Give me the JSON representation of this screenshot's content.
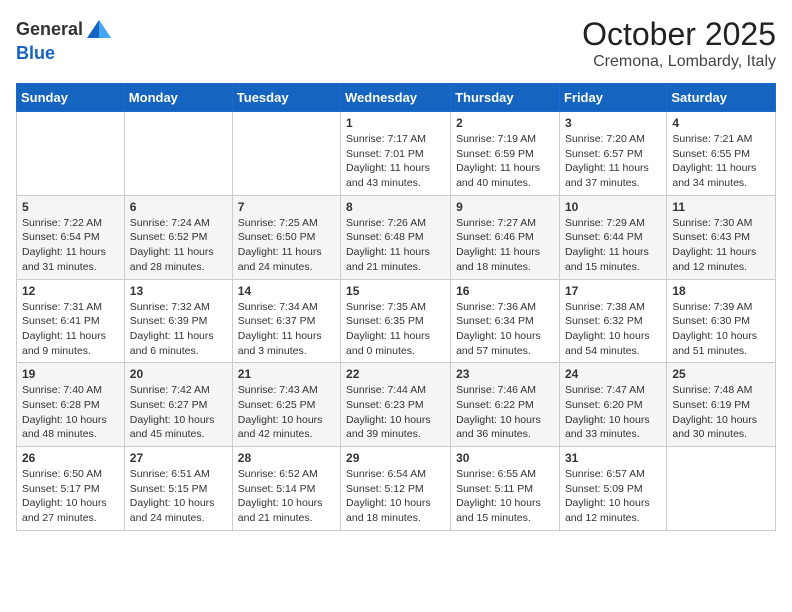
{
  "header": {
    "logo_general": "General",
    "logo_blue": "Blue",
    "month_title": "October 2025",
    "location": "Cremona, Lombardy, Italy"
  },
  "weekdays": [
    "Sunday",
    "Monday",
    "Tuesday",
    "Wednesday",
    "Thursday",
    "Friday",
    "Saturday"
  ],
  "weeks": [
    [
      {
        "day": "",
        "info": ""
      },
      {
        "day": "",
        "info": ""
      },
      {
        "day": "",
        "info": ""
      },
      {
        "day": "1",
        "info": "Sunrise: 7:17 AM\nSunset: 7:01 PM\nDaylight: 11 hours and 43 minutes."
      },
      {
        "day": "2",
        "info": "Sunrise: 7:19 AM\nSunset: 6:59 PM\nDaylight: 11 hours and 40 minutes."
      },
      {
        "day": "3",
        "info": "Sunrise: 7:20 AM\nSunset: 6:57 PM\nDaylight: 11 hours and 37 minutes."
      },
      {
        "day": "4",
        "info": "Sunrise: 7:21 AM\nSunset: 6:55 PM\nDaylight: 11 hours and 34 minutes."
      }
    ],
    [
      {
        "day": "5",
        "info": "Sunrise: 7:22 AM\nSunset: 6:54 PM\nDaylight: 11 hours and 31 minutes."
      },
      {
        "day": "6",
        "info": "Sunrise: 7:24 AM\nSunset: 6:52 PM\nDaylight: 11 hours and 28 minutes."
      },
      {
        "day": "7",
        "info": "Sunrise: 7:25 AM\nSunset: 6:50 PM\nDaylight: 11 hours and 24 minutes."
      },
      {
        "day": "8",
        "info": "Sunrise: 7:26 AM\nSunset: 6:48 PM\nDaylight: 11 hours and 21 minutes."
      },
      {
        "day": "9",
        "info": "Sunrise: 7:27 AM\nSunset: 6:46 PM\nDaylight: 11 hours and 18 minutes."
      },
      {
        "day": "10",
        "info": "Sunrise: 7:29 AM\nSunset: 6:44 PM\nDaylight: 11 hours and 15 minutes."
      },
      {
        "day": "11",
        "info": "Sunrise: 7:30 AM\nSunset: 6:43 PM\nDaylight: 11 hours and 12 minutes."
      }
    ],
    [
      {
        "day": "12",
        "info": "Sunrise: 7:31 AM\nSunset: 6:41 PM\nDaylight: 11 hours and 9 minutes."
      },
      {
        "day": "13",
        "info": "Sunrise: 7:32 AM\nSunset: 6:39 PM\nDaylight: 11 hours and 6 minutes."
      },
      {
        "day": "14",
        "info": "Sunrise: 7:34 AM\nSunset: 6:37 PM\nDaylight: 11 hours and 3 minutes."
      },
      {
        "day": "15",
        "info": "Sunrise: 7:35 AM\nSunset: 6:35 PM\nDaylight: 11 hours and 0 minutes."
      },
      {
        "day": "16",
        "info": "Sunrise: 7:36 AM\nSunset: 6:34 PM\nDaylight: 10 hours and 57 minutes."
      },
      {
        "day": "17",
        "info": "Sunrise: 7:38 AM\nSunset: 6:32 PM\nDaylight: 10 hours and 54 minutes."
      },
      {
        "day": "18",
        "info": "Sunrise: 7:39 AM\nSunset: 6:30 PM\nDaylight: 10 hours and 51 minutes."
      }
    ],
    [
      {
        "day": "19",
        "info": "Sunrise: 7:40 AM\nSunset: 6:28 PM\nDaylight: 10 hours and 48 minutes."
      },
      {
        "day": "20",
        "info": "Sunrise: 7:42 AM\nSunset: 6:27 PM\nDaylight: 10 hours and 45 minutes."
      },
      {
        "day": "21",
        "info": "Sunrise: 7:43 AM\nSunset: 6:25 PM\nDaylight: 10 hours and 42 minutes."
      },
      {
        "day": "22",
        "info": "Sunrise: 7:44 AM\nSunset: 6:23 PM\nDaylight: 10 hours and 39 minutes."
      },
      {
        "day": "23",
        "info": "Sunrise: 7:46 AM\nSunset: 6:22 PM\nDaylight: 10 hours and 36 minutes."
      },
      {
        "day": "24",
        "info": "Sunrise: 7:47 AM\nSunset: 6:20 PM\nDaylight: 10 hours and 33 minutes."
      },
      {
        "day": "25",
        "info": "Sunrise: 7:48 AM\nSunset: 6:19 PM\nDaylight: 10 hours and 30 minutes."
      }
    ],
    [
      {
        "day": "26",
        "info": "Sunrise: 6:50 AM\nSunset: 5:17 PM\nDaylight: 10 hours and 27 minutes."
      },
      {
        "day": "27",
        "info": "Sunrise: 6:51 AM\nSunset: 5:15 PM\nDaylight: 10 hours and 24 minutes."
      },
      {
        "day": "28",
        "info": "Sunrise: 6:52 AM\nSunset: 5:14 PM\nDaylight: 10 hours and 21 minutes."
      },
      {
        "day": "29",
        "info": "Sunrise: 6:54 AM\nSunset: 5:12 PM\nDaylight: 10 hours and 18 minutes."
      },
      {
        "day": "30",
        "info": "Sunrise: 6:55 AM\nSunset: 5:11 PM\nDaylight: 10 hours and 15 minutes."
      },
      {
        "day": "31",
        "info": "Sunrise: 6:57 AM\nSunset: 5:09 PM\nDaylight: 10 hours and 12 minutes."
      },
      {
        "day": "",
        "info": ""
      }
    ]
  ]
}
